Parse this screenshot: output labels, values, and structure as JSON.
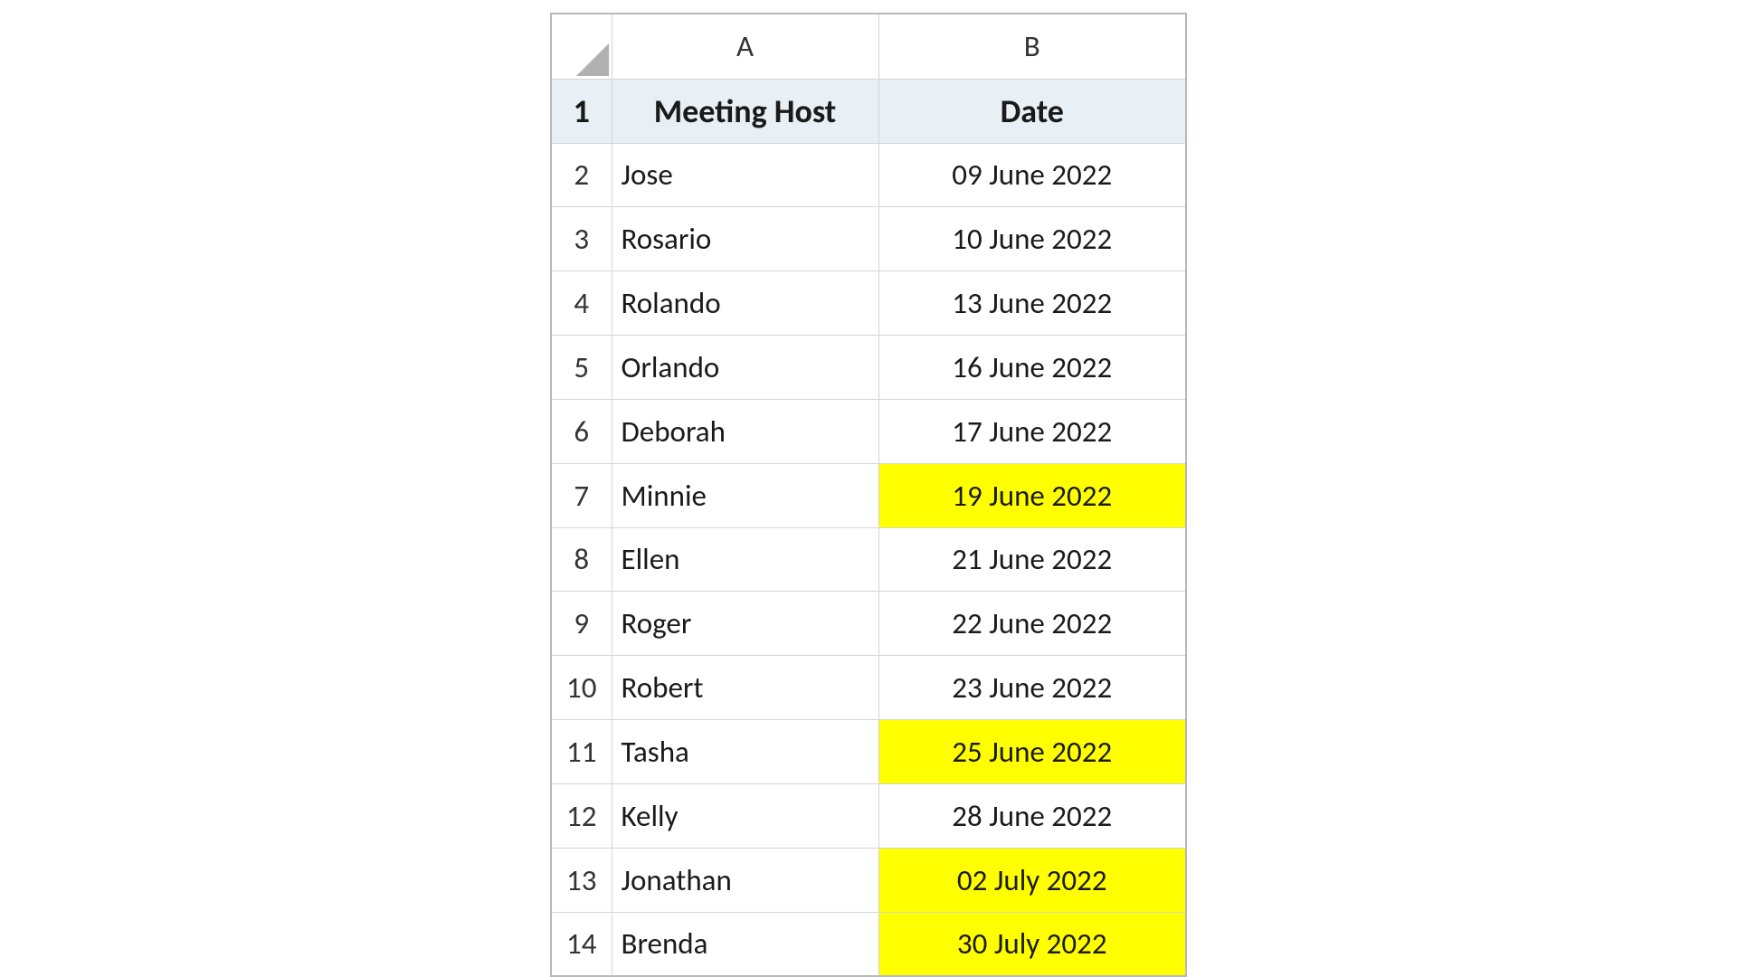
{
  "columns": {
    "A": "A",
    "B": "B"
  },
  "headers": {
    "A": "Meeting Host",
    "B": "Date"
  },
  "rows": [
    {
      "num": "1"
    },
    {
      "num": "2",
      "host": "Jose",
      "date": "09 June 2022",
      "highlight": false
    },
    {
      "num": "3",
      "host": "Rosario",
      "date": "10 June 2022",
      "highlight": false
    },
    {
      "num": "4",
      "host": "Rolando",
      "date": "13 June 2022",
      "highlight": false
    },
    {
      "num": "5",
      "host": "Orlando",
      "date": "16 June 2022",
      "highlight": false
    },
    {
      "num": "6",
      "host": "Deborah",
      "date": "17 June 2022",
      "highlight": false
    },
    {
      "num": "7",
      "host": "Minnie",
      "date": "19 June 2022",
      "highlight": true
    },
    {
      "num": "8",
      "host": "Ellen",
      "date": "21 June 2022",
      "highlight": false
    },
    {
      "num": "9",
      "host": "Roger",
      "date": "22 June 2022",
      "highlight": false
    },
    {
      "num": "10",
      "host": "Robert",
      "date": "23 June 2022",
      "highlight": false
    },
    {
      "num": "11",
      "host": "Tasha",
      "date": "25 June 2022",
      "highlight": true
    },
    {
      "num": "12",
      "host": "Kelly",
      "date": "28 June 2022",
      "highlight": false
    },
    {
      "num": "13",
      "host": "Jonathan",
      "date": "02 July 2022",
      "highlight": true
    },
    {
      "num": "14",
      "host": "Brenda",
      "date": "30 July 2022",
      "highlight": true
    }
  ],
  "chart_data": {
    "type": "table",
    "title": "",
    "columns": [
      "Meeting Host",
      "Date"
    ],
    "data": [
      [
        "Jose",
        "09 June 2022"
      ],
      [
        "Rosario",
        "10 June 2022"
      ],
      [
        "Rolando",
        "13 June 2022"
      ],
      [
        "Orlando",
        "16 June 2022"
      ],
      [
        "Deborah",
        "17 June 2022"
      ],
      [
        "Minnie",
        "19 June 2022"
      ],
      [
        "Ellen",
        "21 June 2022"
      ],
      [
        "Roger",
        "22 June 2022"
      ],
      [
        "Robert",
        "23 June 2022"
      ],
      [
        "Tasha",
        "25 June 2022"
      ],
      [
        "Kelly",
        "28 June 2022"
      ],
      [
        "Jonathan",
        "02 July 2022"
      ],
      [
        "Brenda",
        "30 July 2022"
      ]
    ],
    "highlighted_rows": [
      5,
      9,
      11,
      12
    ]
  }
}
